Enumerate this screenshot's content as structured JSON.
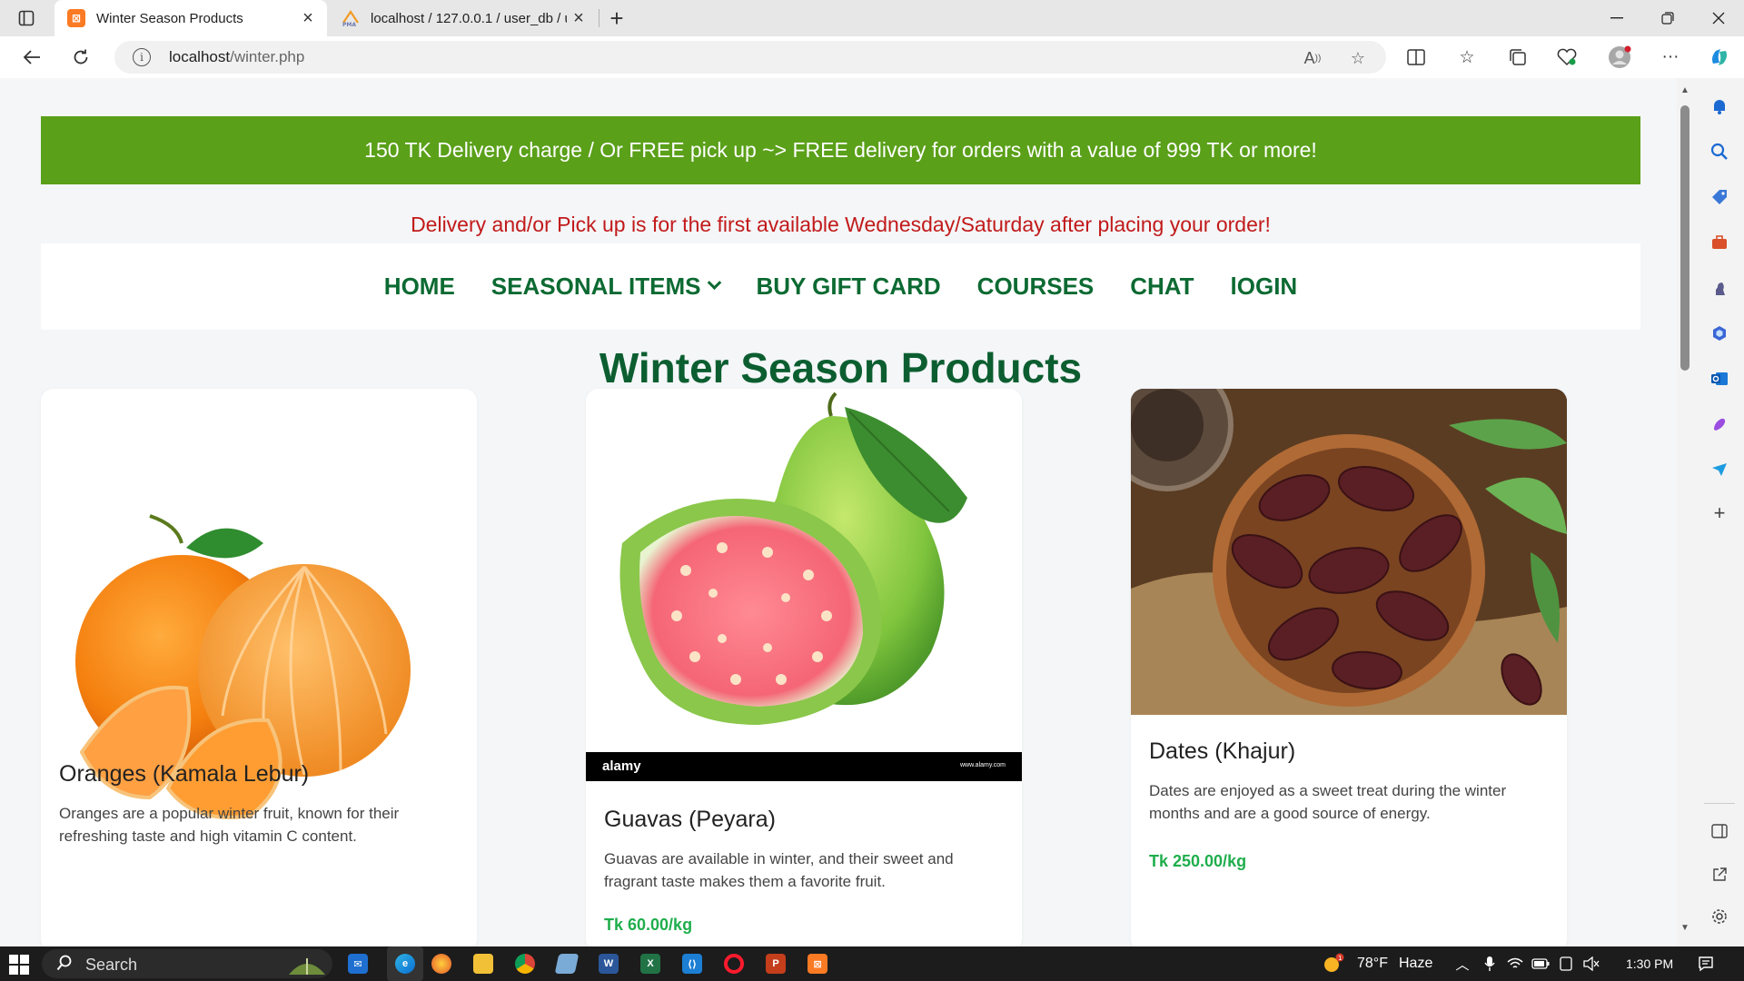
{
  "browser": {
    "tabs": [
      {
        "title": "Winter Season Products",
        "favicon": "xampp-icon",
        "active": true
      },
      {
        "title": "localhost / 127.0.0.1 / user_db / u",
        "favicon": "phpmyadmin-icon",
        "active": false
      }
    ],
    "url": {
      "host": "localhost",
      "path": "/winter.php"
    }
  },
  "page": {
    "promo": "150 TK Delivery charge / Or FREE pick up ~> FREE delivery for orders with a value of 999 TK or more!",
    "notice": "Delivery and/or Pick up is for the first available Wednesday/Saturday after placing your order!",
    "menu": {
      "home": "HOME",
      "seasonal": "SEASONAL ITEMS",
      "gift": "BUY GIFT CARD",
      "courses": "COURSES",
      "chat": "CHAT",
      "login": "lOGIN"
    },
    "title": "Winter Season Products",
    "products": [
      {
        "name": "Oranges (Kamala Lebur)",
        "desc": "Oranges are a popular winter fruit, known for their refreshing taste and high vitamin C content.",
        "price": ""
      },
      {
        "name": "Guavas (Peyara)",
        "desc": "Guavas are available in winter, and their sweet and fragrant taste makes them a favorite fruit.",
        "price": "Tk 60.00/kg",
        "watermark": "alamy",
        "watermark_url": "www.alamy.com"
      },
      {
        "name": "Dates (Khajur)",
        "desc": "Dates are enjoyed as a sweet treat during the winter months and are a good source of energy.",
        "price": "Tk 250.00/kg"
      }
    ]
  },
  "taskbar": {
    "search": "Search",
    "weather": "78°F",
    "weather_desc": "Haze",
    "time": "1:30 PM"
  },
  "colors": {
    "promo_bg": "#5aa019",
    "menu_green": "#0c6a32",
    "notice_red": "#c21a1a",
    "price_green": "#1fae4c"
  }
}
